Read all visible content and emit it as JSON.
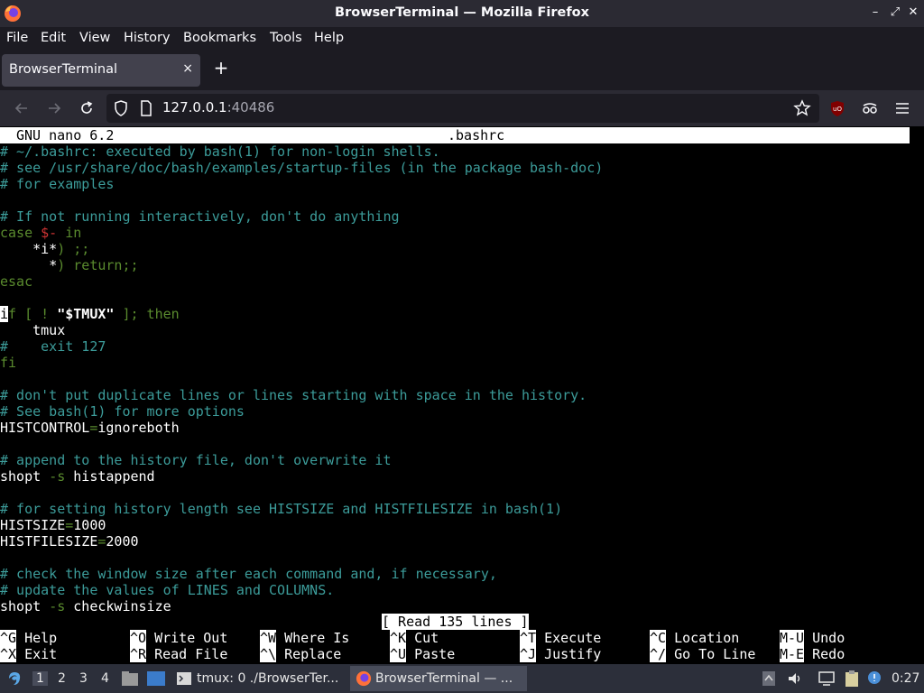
{
  "window": {
    "title": "BrowserTerminal — Mozilla Firefox"
  },
  "menubar": [
    "File",
    "Edit",
    "View",
    "History",
    "Bookmarks",
    "Tools",
    "Help"
  ],
  "tab": {
    "label": "BrowserTerminal",
    "close": "×"
  },
  "newtab": "+",
  "url": {
    "host": "127.0.0.1",
    "port": ":40486"
  },
  "nano": {
    "version": "GNU nano 6.2",
    "filename": ".bashrc",
    "status": "[ Read 135 lines ]",
    "lines": [
      "# ~/.bashrc: executed by bash(1) for non-login shells.",
      "# see /usr/share/doc/bash/examples/startup-files (in the package bash-doc)",
      "# for examples",
      "",
      "# If not running interactively, don't do anything",
      "case $- in",
      "    *i*) ;;",
      "      *) return;;",
      "esac",
      "",
      "if [ ! \"$TMUX\" ]; then",
      "    tmux",
      "#    exit 127",
      "fi",
      "",
      "# don't put duplicate lines or lines starting with space in the history.",
      "# See bash(1) for more options",
      "HISTCONTROL=ignoreboth",
      "",
      "# append to the history file, don't overwrite it",
      "shopt -s histappend",
      "",
      "# for setting history length see HISTSIZE and HISTFILESIZE in bash(1)",
      "HISTSIZE=1000",
      "HISTFILESIZE=2000",
      "",
      "# check the window size after each command and, if necessary,",
      "# update the values of LINES and COLUMNS.",
      "shopt -s checkwinsize"
    ],
    "shortcuts": [
      {
        "key": "^G",
        "label": "Help"
      },
      {
        "key": "^O",
        "label": "Write Out"
      },
      {
        "key": "^W",
        "label": "Where Is"
      },
      {
        "key": "^K",
        "label": "Cut"
      },
      {
        "key": "^T",
        "label": "Execute"
      },
      {
        "key": "^C",
        "label": "Location"
      },
      {
        "key": "M-U",
        "label": "Undo"
      },
      {
        "key": "^X",
        "label": "Exit"
      },
      {
        "key": "^R",
        "label": "Read File"
      },
      {
        "key": "^\\",
        "label": "Replace"
      },
      {
        "key": "^U",
        "label": "Paste"
      },
      {
        "key": "^J",
        "label": "Justify"
      },
      {
        "key": "^/",
        "label": "Go To Line"
      },
      {
        "key": "M-E",
        "label": "Redo"
      }
    ]
  },
  "taskbar": {
    "workspaces": [
      "1",
      "2",
      "3",
      "4"
    ],
    "tasks": [
      {
        "label": "tmux: 0 ./BrowserTer..."
      },
      {
        "label": "BrowserTerminal — ..."
      }
    ],
    "clock": "0:27"
  },
  "colors": {
    "comment": "#3c9c9a",
    "keyword": "#5a8b2e",
    "variable": "#d03434"
  }
}
